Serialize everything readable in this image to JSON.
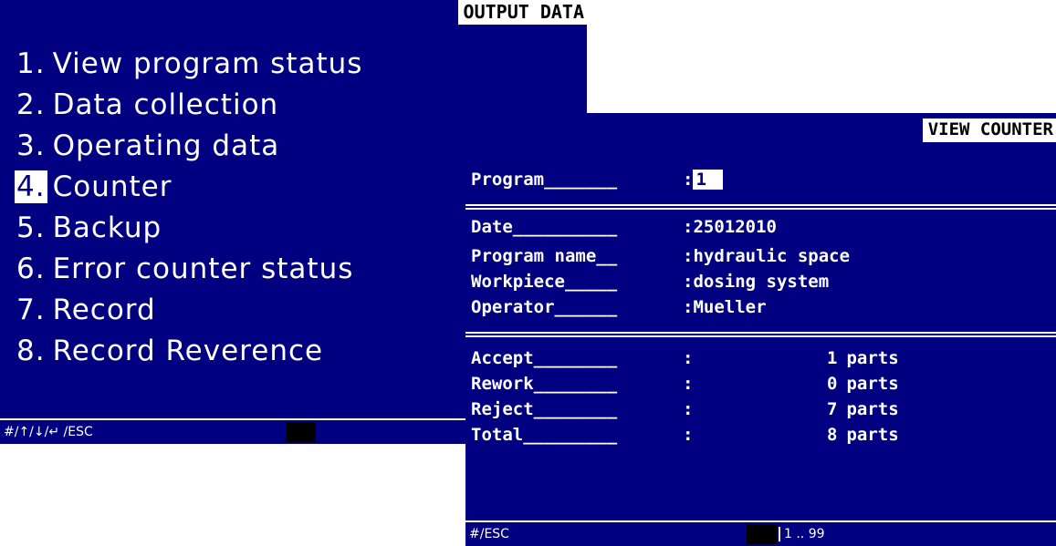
{
  "output_screen": {
    "title": "OUTPUT DATA",
    "menu": [
      {
        "num": "1.",
        "label": "View program status",
        "selected": false
      },
      {
        "num": "2.",
        "label": "Data collection",
        "selected": false
      },
      {
        "num": "3.",
        "label": "Operating data",
        "selected": false
      },
      {
        "num": "4.",
        "label": "Counter",
        "selected": true
      },
      {
        "num": "5.",
        "label": "Backup",
        "selected": false
      },
      {
        "num": "6.",
        "label": "Error counter status",
        "selected": false
      },
      {
        "num": "7.",
        "label": "Record",
        "selected": false
      },
      {
        "num": "8.",
        "label": "Record Reverence",
        "selected": false
      }
    ],
    "statusbar": {
      "keys": "#/↑/↓/↵ /ESC"
    }
  },
  "counter_screen": {
    "title": "VIEW COUNTER",
    "program": {
      "label": "Program_______",
      "value": "1"
    },
    "info": [
      {
        "label": "Date__________",
        "value": "25012010"
      },
      {
        "label": "Program name__",
        "value": "hydraulic space"
      },
      {
        "label": "Workpiece_____",
        "value": "dosing system"
      },
      {
        "label": "Operator______",
        "value": "Mueller"
      }
    ],
    "counts": [
      {
        "label": "Accept________",
        "value": "1",
        "unit": "parts"
      },
      {
        "label": "Rework________",
        "value": "0",
        "unit": "parts"
      },
      {
        "label": "Reject________",
        "value": "7",
        "unit": "parts"
      },
      {
        "label": "Total_________",
        "value": "8",
        "unit": "parts"
      }
    ],
    "separator": ":",
    "statusbar": {
      "keys": "#/ESC",
      "range": "1 .. 99"
    }
  },
  "colors": {
    "screen_bg": "#000080",
    "text": "#ffffff",
    "cursor": "#000000"
  }
}
